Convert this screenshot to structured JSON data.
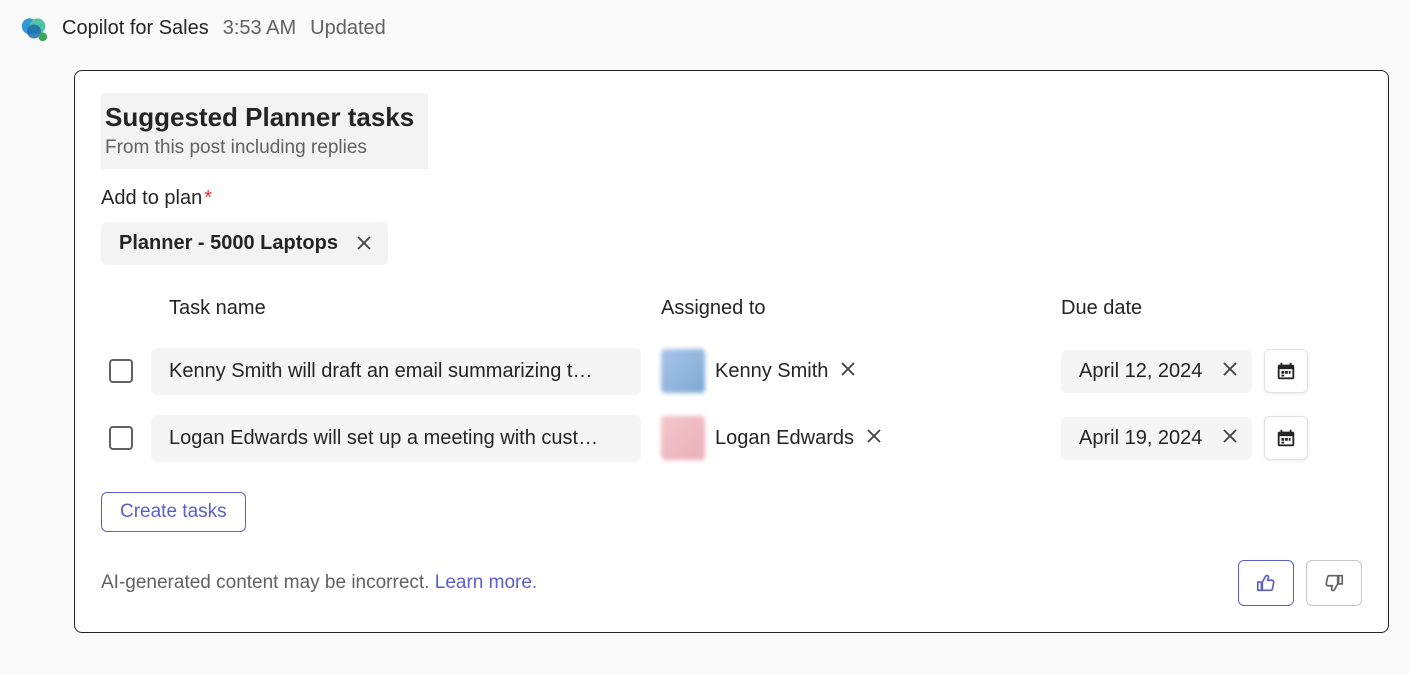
{
  "header": {
    "app_name": "Copilot for Sales",
    "timestamp": "3:53 AM",
    "status": "Updated"
  },
  "card": {
    "title": "Suggested Planner tasks",
    "subtitle": "From this post including replies",
    "plan": {
      "label": "Add to plan",
      "selected": "Planner - 5000 Laptops"
    },
    "columns": {
      "task": "Task name",
      "assignee": "Assigned to",
      "due": "Due date"
    },
    "tasks": [
      {
        "name": "Kenny Smith will draft an email summarizing t…",
        "assignee": "Kenny Smith",
        "avatar_color": "blue",
        "due": "April 12, 2024"
      },
      {
        "name": "Logan Edwards will set up a meeting with cust…",
        "assignee": "Logan Edwards",
        "avatar_color": "pink",
        "due": "April 19, 2024"
      }
    ],
    "create_button": "Create tasks",
    "disclaimer": "AI-generated content may be incorrect.",
    "learn_more": "Learn more."
  }
}
